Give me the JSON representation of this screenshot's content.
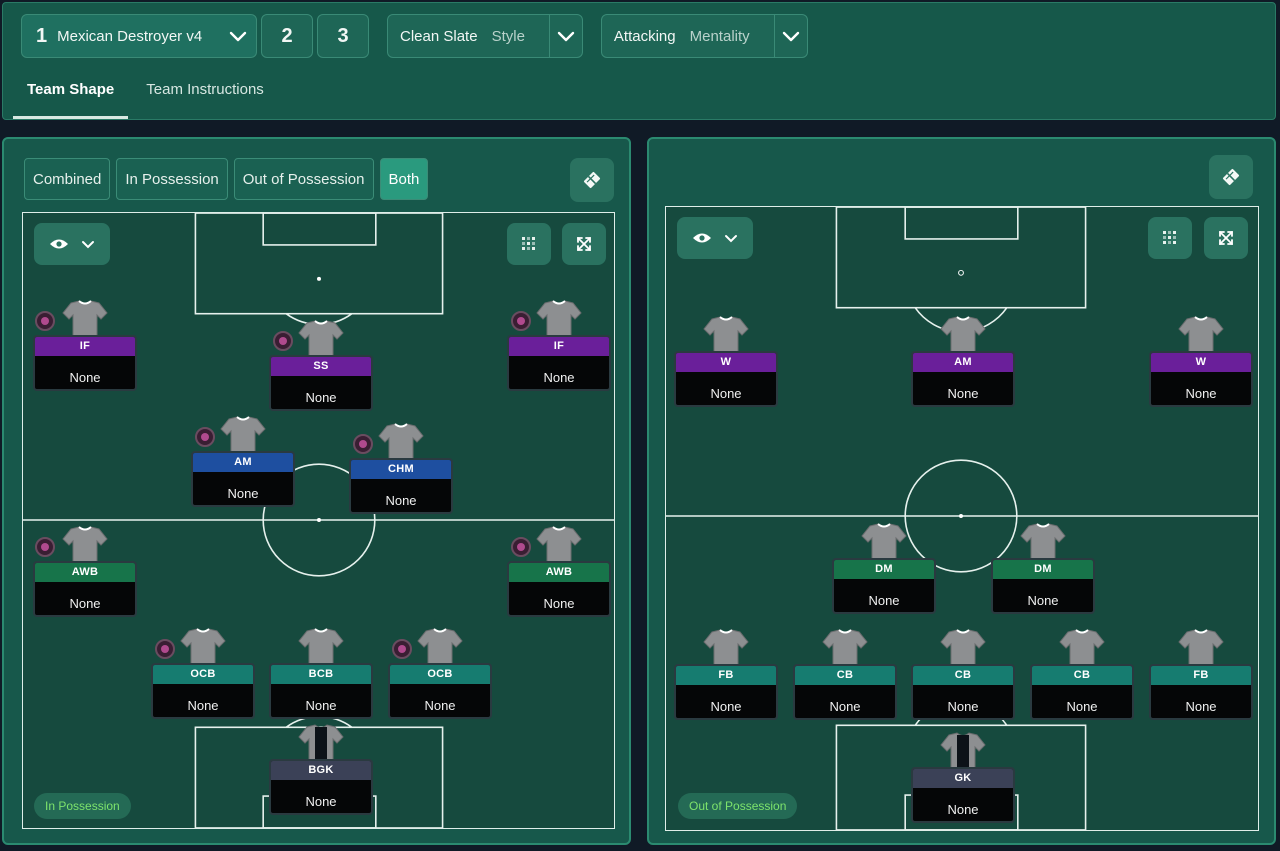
{
  "toolbar": {
    "tactic_number": "1",
    "tactic_name": "Mexican Destroyer v4",
    "slot2": "2",
    "slot3": "3",
    "style_value": "Clean Slate",
    "style_label": "Style",
    "mentality_value": "Attacking",
    "mentality_label": "Mentality"
  },
  "tabs": [
    "Team Shape",
    "Team Instructions"
  ],
  "phase_buttons": [
    "Combined",
    "In Possession",
    "Out of Possession",
    "Both"
  ],
  "left": {
    "badge": "In Possession",
    "players": [
      {
        "role": "IF",
        "duty": "None"
      },
      {
        "role": "SS",
        "duty": "None"
      },
      {
        "role": "IF",
        "duty": "None"
      },
      {
        "role": "AM",
        "duty": "None"
      },
      {
        "role": "CHM",
        "duty": "None"
      },
      {
        "role": "AWB",
        "duty": "None"
      },
      {
        "role": "AWB",
        "duty": "None"
      },
      {
        "role": "OCB",
        "duty": "None"
      },
      {
        "role": "BCB",
        "duty": "None"
      },
      {
        "role": "OCB",
        "duty": "None"
      },
      {
        "role": "BGK",
        "duty": "None"
      }
    ]
  },
  "right": {
    "badge": "Out of Possession",
    "players": [
      {
        "role": "W",
        "duty": "None"
      },
      {
        "role": "AM",
        "duty": "None"
      },
      {
        "role": "W",
        "duty": "None"
      },
      {
        "role": "DM",
        "duty": "None"
      },
      {
        "role": "DM",
        "duty": "None"
      },
      {
        "role": "FB",
        "duty": "None"
      },
      {
        "role": "CB",
        "duty": "None"
      },
      {
        "role": "CB",
        "duty": "None"
      },
      {
        "role": "CB",
        "duty": "None"
      },
      {
        "role": "FB",
        "duty": "None"
      },
      {
        "role": "GK",
        "duty": "None"
      }
    ]
  },
  "icons": [
    "chevron-down-icon",
    "eye-icon",
    "grid-icon",
    "expand-icon",
    "pitch-settings-icon",
    "shirt-icon",
    "instruction-icon"
  ],
  "colors": {
    "attack_role": "#6a1f9a",
    "midfield_role": "#1e4fa0",
    "wingback_role": "#17744a",
    "defence_role": "#167c70",
    "keeper_role": "#3b4157",
    "badge_text": "#7de36c"
  }
}
